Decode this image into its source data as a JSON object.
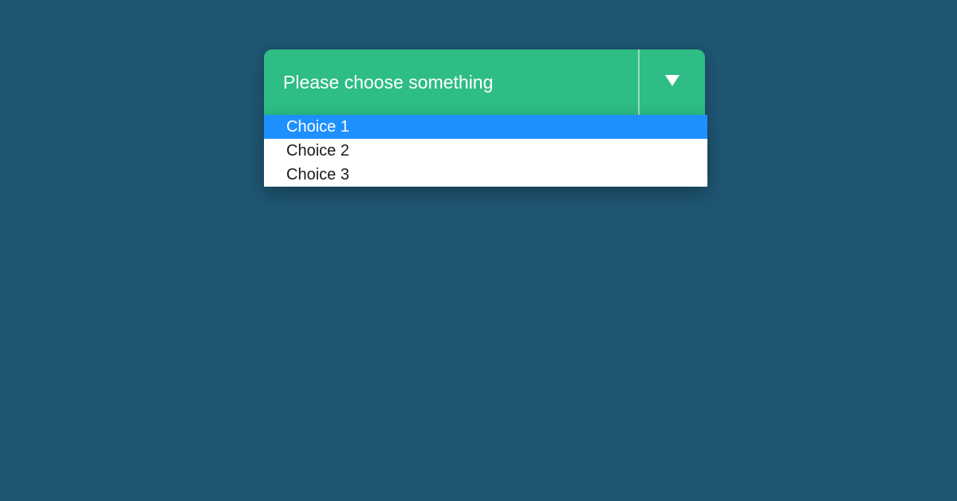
{
  "dropdown": {
    "placeholder": "Please choose something",
    "options": {
      "0": "Choice 1",
      "1": "Choice 2",
      "2": "Choice 3"
    }
  }
}
